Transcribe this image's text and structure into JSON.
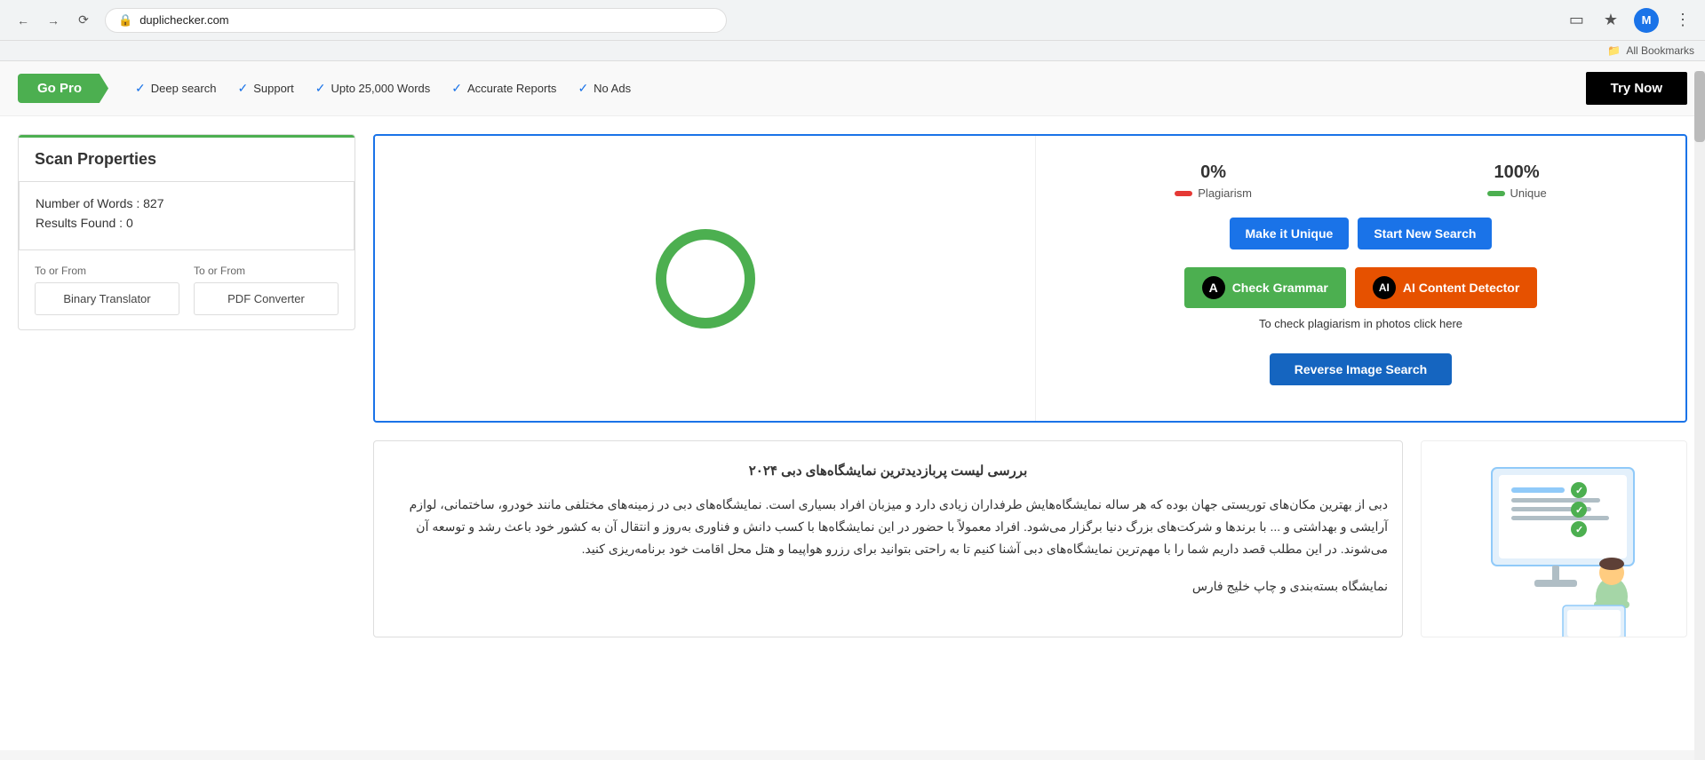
{
  "browser": {
    "url": "duplichecker.com",
    "bookmark_label": "All Bookmarks",
    "profile_initial": "M"
  },
  "banner": {
    "go_pro": "Go Pro",
    "try_now": "Try Now",
    "features": [
      "Deep search",
      "Support",
      "Upto 25,000 Words",
      "Accurate Reports",
      "No Ads"
    ]
  },
  "scan_properties": {
    "title": "Scan Properties",
    "words_label": "Number of Words",
    "words_value": "827",
    "results_label": "Results Found",
    "results_value": "0",
    "tool1_label": "To or From",
    "tool1_btn": "Binary Translator",
    "tool2_label": "To or From",
    "tool2_btn": "PDF Converter"
  },
  "results": {
    "plagiarism_percent": "0%",
    "unique_percent": "100%",
    "plagiarism_label": "Plagiarism",
    "unique_label": "Unique",
    "make_unique_btn": "Make it Unique",
    "start_new_btn": "Start New Search",
    "grammar_btn": "Check Grammar",
    "ai_btn": "AI Content Detector",
    "photo_plag_text": "To check plagiarism in photos click here",
    "reverse_image_btn": "Reverse Image Search"
  },
  "text_content": {
    "title": "بررسی لیست پربازدیدترین نمایشگاه‌های دبی ۲۰۲۴",
    "para1": "دبی از بهترین مکان‌های توریستی جهان بوده که هر ساله نمایشگاه‌هایش طرفداران زیادی دارد و میزبان افراد بسیاری است. نمایشگاه‌های دبی در زمینه‌های مختلفی مانند خودرو، ساختمانی، لوازم آرایشی و بهداشتی و ... با برندها و شرکت‌های بزرگ دنیا برگزار می‌شود. افراد معمولاً با حضور در این نمایشگاه‌ها با کسب دانش و فناوری به‌روز و انتقال آن به کشور خود باعث رشد و توسعه آن می‌شوند. در این مطلب قصد داریم شما را با مهم‌ترین نمایشگاه‌های دبی آشنا کنیم تا به راحتی بتوانید برای رزرو هواپیما و هتل محل اقامت خود برنامه‌ریزی کنید.",
    "subtitle": "نمایشگاه بسته‌بندی و چاپ خلیج فارس"
  }
}
